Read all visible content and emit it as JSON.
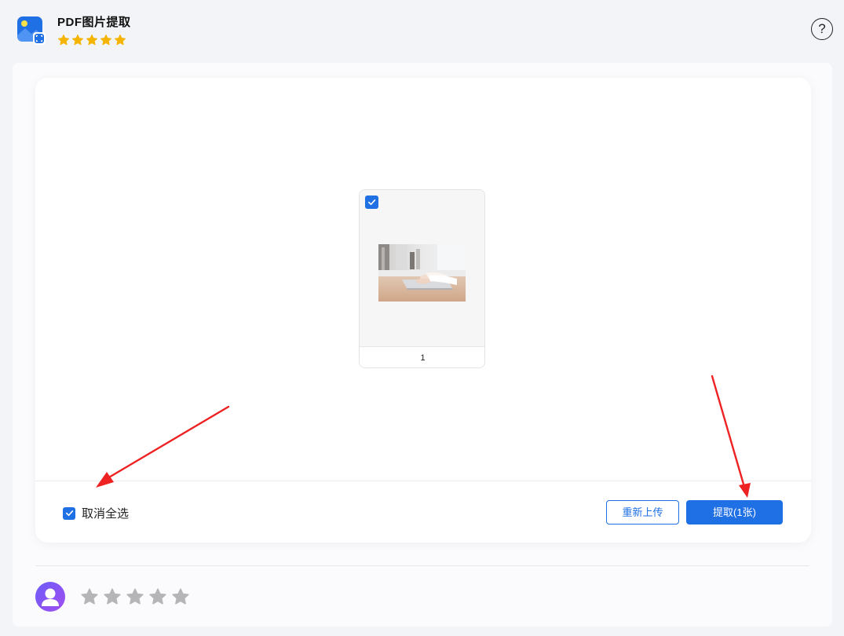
{
  "app": {
    "title": "PDF图片提取",
    "rating_stars": 5,
    "icon": "image-extract-icon",
    "help_icon": "question-icon",
    "help_label": "?"
  },
  "thumbnails": [
    {
      "page_label": "1",
      "checked": true,
      "image": "laptop-typing-photo"
    }
  ],
  "footer": {
    "select_all_label": "取消全选",
    "select_all_checked": true,
    "reupload_label": "重新上传",
    "extract_label": "提取(1张)"
  },
  "feedback": {
    "avatar_icon": "user-avatar-icon",
    "rating_stars": 5,
    "rating_value": 0
  },
  "annotations": {
    "arrow_color": "#ee2222",
    "arrows": [
      "select-all-arrow",
      "extract-arrow"
    ]
  },
  "colors": {
    "accent": "#1f6fe5",
    "star_gold": "#f5b400",
    "star_gray": "#b5b5b8",
    "avatar_start": "#6c5cf7",
    "avatar_end": "#a24ef0"
  }
}
